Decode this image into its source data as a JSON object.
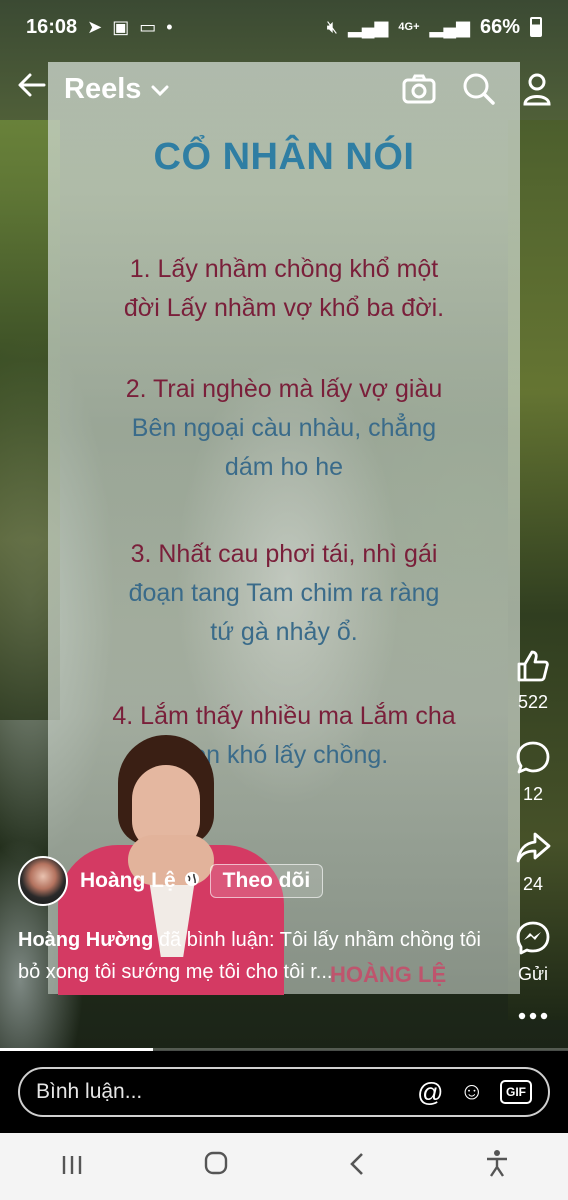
{
  "status_bar": {
    "time": "16:08",
    "network": "4G+",
    "battery": "66%"
  },
  "top_bar": {
    "title": "Reels"
  },
  "poster": {
    "title": "CỔ NHÂN NÓI",
    "verses": [
      {
        "line1": "1. Lấy nhầm chồng khổ một",
        "line2": "đời Lấy nhầm vợ khổ ba đời."
      },
      {
        "line1": "2. Trai nghèo mà lấy vợ giàu",
        "line2": "Bên ngoại càu nhàu, chẳng",
        "line3": "dám ho he"
      },
      {
        "line1": "3. Nhất cau phơi tái, nhì gái",
        "line2": "đoạn tang Tam chim ra ràng",
        "line3": "tứ gà nhảy ổ."
      },
      {
        "line1": "4. Lắm thấy nhiều ma Lắm cha",
        "line2": "con khó lấy chồng."
      }
    ],
    "watermark": "HOÀNG LỆ"
  },
  "rail": {
    "likes": "522",
    "comments": "12",
    "shares": "24",
    "send_label": "Gửi"
  },
  "author": {
    "name": "Hoàng Lệ",
    "follow_label": "Theo dõi"
  },
  "comment_preview": {
    "commenter": "Hoàng Hường",
    "text": " đã bình luận: Tôi lấy nhầm chồng tôi bỏ xong tôi sướng mẹ tôi cho tôi r..."
  },
  "comment_bar": {
    "placeholder": "Bình luận...",
    "gif_label": "GIF"
  },
  "progress": 0.27,
  "colors": {
    "poster_title": "#2f7ea3",
    "verse_red": "#7a1f3a",
    "verse_blue": "#3a6b8a",
    "jacket": "#d43a63"
  }
}
